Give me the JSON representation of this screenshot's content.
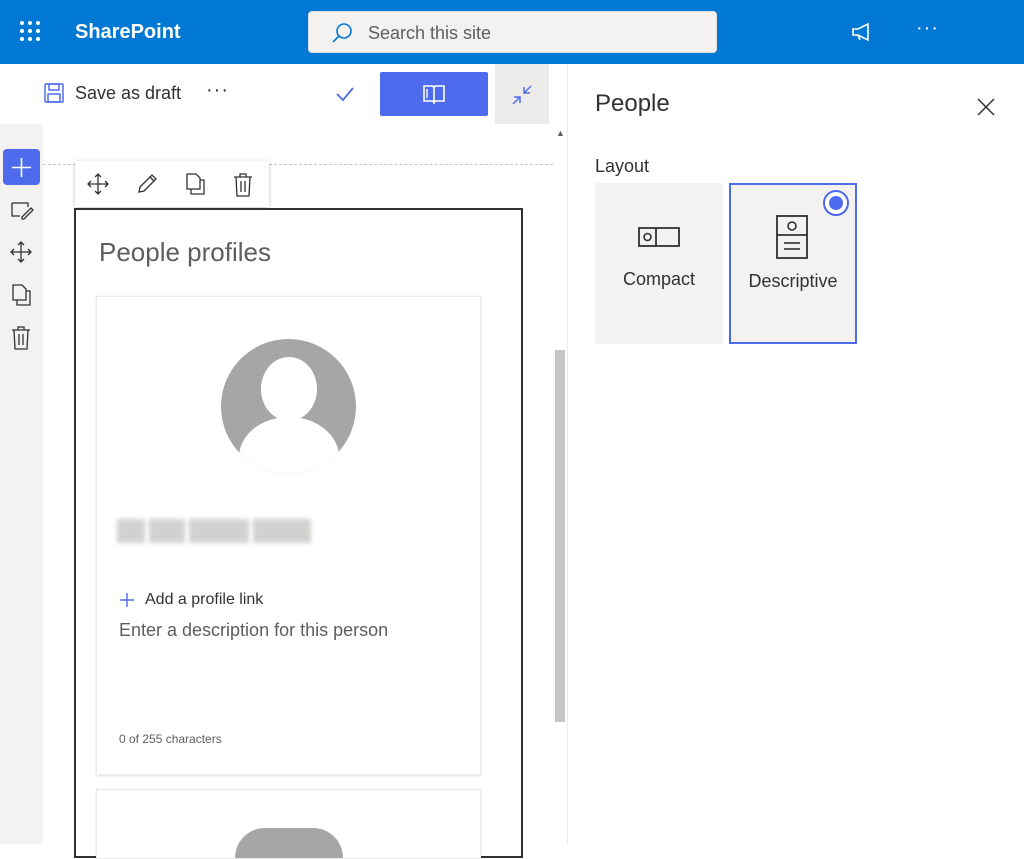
{
  "suite_bar": {
    "app_name": "SharePoint",
    "search_placeholder": "Search this site",
    "more_label": "···"
  },
  "command_bar": {
    "save_label": "Save as draft",
    "more_label": "···"
  },
  "canvas": {
    "web_part_title": "People profiles",
    "profile_card": {
      "add_link_label": "Add a profile link",
      "description_placeholder": "Enter a description for this person",
      "char_count": "0 of 255 characters"
    }
  },
  "property_pane": {
    "title": "People",
    "layout_label": "Layout",
    "layout_options": [
      {
        "label": "Compact",
        "selected": false
      },
      {
        "label": "Descriptive",
        "selected": true
      }
    ]
  },
  "colors": {
    "suite_bar": "#0078d4",
    "accent": "#4f6bed"
  },
  "icons": [
    "waffle-icon",
    "search-icon",
    "megaphone-icon",
    "save-icon",
    "check-icon",
    "book-icon",
    "collapse-icon",
    "plus-icon",
    "edit-section-icon",
    "move-icon",
    "copy-icon",
    "delete-icon",
    "pencil-icon",
    "close-icon",
    "compact-layout-icon",
    "descriptive-layout-icon"
  ]
}
